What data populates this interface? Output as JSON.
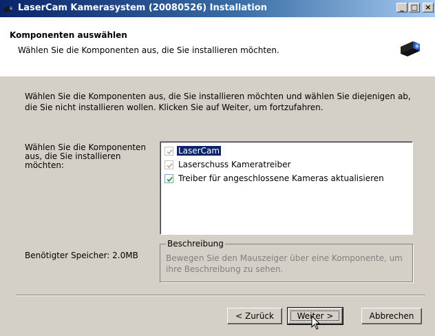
{
  "window": {
    "title": "LaserCam Kamerasystem (20080526) Installation",
    "controls": {
      "minimize": "_",
      "maximize": "□",
      "close": "×"
    }
  },
  "header": {
    "title": "Komponenten auswählen",
    "subtitle": "Wählen Sie die Komponenten aus, die Sie installieren möchten.",
    "icon": "camera-icon"
  },
  "body": {
    "description": "Wählen Sie die Komponenten aus, die Sie installieren möchten und wählen Sie diejenigen ab, die Sie nicht installieren wollen. Klicken Sie auf Weiter, um fortzufahren.",
    "components_label": "Wählen Sie die Komponenten aus, die Sie installieren möchten:",
    "components": [
      {
        "label": "LaserCam",
        "checked": true,
        "disabled": true,
        "selected": true
      },
      {
        "label": "Laserschuss Kameratreiber",
        "checked": true,
        "disabled": true,
        "selected": false
      },
      {
        "label": "Treiber für angeschlossene Kameras aktualisieren",
        "checked": true,
        "disabled": false,
        "selected": false
      }
    ],
    "description_group": {
      "title": "Beschreibung",
      "text": "Bewegen Sie den Mauszeiger über eine Komponente, um ihre Beschreibung zu sehen."
    },
    "space_required": "Benötigter Speicher: 2.0MB"
  },
  "footer": {
    "back_label": "< Zurück",
    "next_label": "Weiter >",
    "cancel_label": "Abbrechen"
  },
  "colors": {
    "title_gradient_start": "#0a246a",
    "title_gradient_end": "#a6caf0",
    "selection": "#0a246a",
    "check_green": "#21a121",
    "check_disabled": "#b5b2a6"
  }
}
